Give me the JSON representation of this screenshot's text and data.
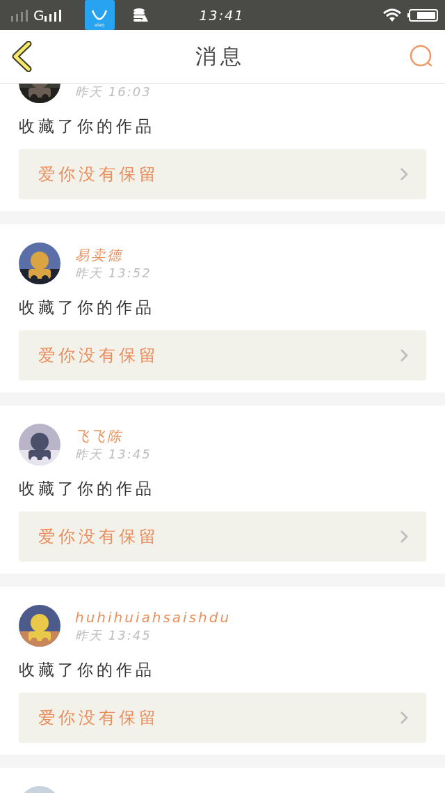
{
  "status_bar": {
    "network": "G",
    "app_badge": "vivo",
    "time": "13:41"
  },
  "header": {
    "title": "消息"
  },
  "messages": [
    {
      "avatar": {
        "kind": "picture"
      },
      "time": "昨天 16:03",
      "action": "收藏了你的作品",
      "work": "爱你没有保留"
    },
    {
      "avatar": {
        "kind": "picture"
      },
      "name": "易卖德",
      "time": "昨天 13:52",
      "action": "收藏了你的作品",
      "work": "爱你没有保留"
    },
    {
      "avatar": {
        "kind": "picture"
      },
      "name": "飞飞陈",
      "time": "昨天 13:45",
      "action": "收藏了你的作品",
      "work": "爱你没有保留"
    },
    {
      "avatar": {
        "kind": "picture"
      },
      "name": "huhihuiahsaishdu",
      "time": "昨天 13:45",
      "action": "收藏了你的作品",
      "work": "爱你没有保留"
    },
    {
      "avatar": {
        "kind": "picture"
      }
    }
  ]
}
